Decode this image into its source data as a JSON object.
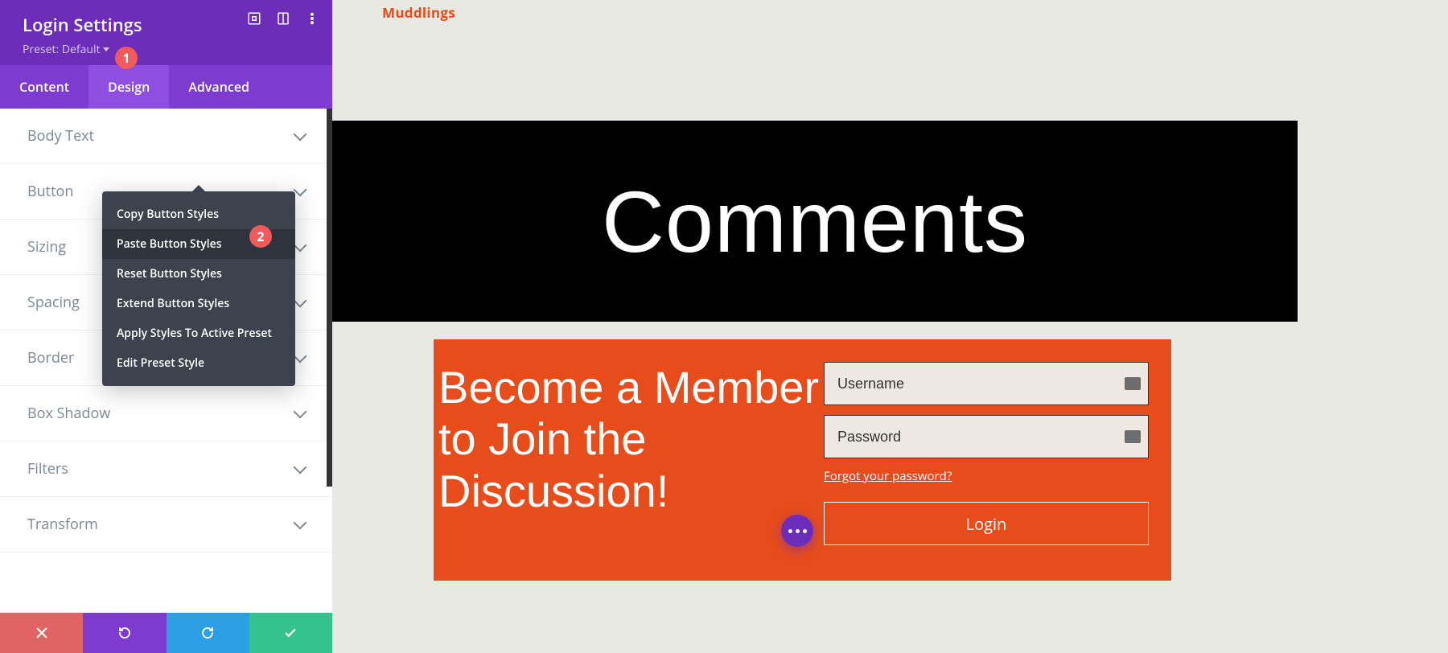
{
  "sidebar": {
    "title": "Login Settings",
    "preset_label": "Preset: Default",
    "tabs": {
      "content": "Content",
      "design": "Design",
      "advanced": "Advanced"
    },
    "options": [
      "Body Text",
      "Button",
      "Sizing",
      "Spacing",
      "Border",
      "Box Shadow",
      "Filters",
      "Transform"
    ],
    "context_menu": [
      "Copy Button Styles",
      "Paste Button Styles",
      "Reset Button Styles",
      "Extend Button Styles",
      "Apply Styles To Active Preset",
      "Edit Preset Style"
    ]
  },
  "annotations": {
    "badge1": "1",
    "badge2": "2"
  },
  "preview": {
    "crumb": "Muddlings",
    "heading": "Comments",
    "cta_text": "Become a Member to Join the Discussion!",
    "username_placeholder": "Username",
    "password_placeholder": "Password",
    "forgot_text": "Forgot your password?",
    "login_btn": "Login"
  }
}
